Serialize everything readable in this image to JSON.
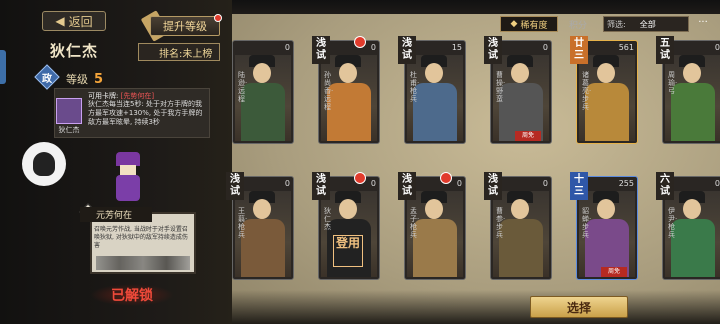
{
  "left": {
    "back_label": "返回",
    "upgrade_label": "提升等级",
    "hero_name": "狄仁杰",
    "rank_label": "排名:未上榜",
    "faction": "政",
    "level_label": "等级",
    "level_value": "5",
    "card_title": "可用卡牌:",
    "card_warning": "[先势何在]",
    "card_thumb_label": "狄仁杰",
    "card_desc": "狄仁杰每当连5秒: 处于对方手牌的我方最军攻速+130%, 处于我方手牌的敌方最军眩晕, 持续3秒",
    "skill_title": "元芳何在",
    "skill_desc": "召唤元芳作战, 当战时于对手设置召唤狄狱, 对狄狱中的敌军持续造成伤害",
    "unlocked_label": "已解锁"
  },
  "right": {
    "tab_active": "稀有度",
    "tab_inactive": "积分",
    "filter_label": "筛选:",
    "filter_value": "全部",
    "more_label": "···",
    "select_label": "选择",
    "cards": [
      {
        "rank": "",
        "cost": "0",
        "vlabel": "陆逊·远程",
        "tag": "",
        "frame": "normal",
        "body": "#3c5a3a"
      },
      {
        "rank": "浅试",
        "cost": "0",
        "vlabel": "孙尚香·远程",
        "tag": "",
        "frame": "normal",
        "body": "#c27a35",
        "alert": true
      },
      {
        "rank": "浅试",
        "cost": "15",
        "vlabel": "杜甫·枪兵",
        "tag": "",
        "frame": "normal",
        "body": "#4d6a8c"
      },
      {
        "rank": "浅试",
        "cost": "0",
        "vlabel": "曹操·野蛮",
        "tag": "周免",
        "frame": "normal",
        "body": "#555"
      },
      {
        "rank": "廿三",
        "cost": "561",
        "vlabel": "诸葛亮·步兵",
        "tag": "",
        "frame": "gold",
        "body": "#b8893a"
      },
      {
        "rank": "五试",
        "cost": "0",
        "vlabel": "周瑜·弓",
        "tag": "",
        "frame": "normal",
        "body": "#4a7a3a"
      },
      {
        "rank": "浅试",
        "cost": "0",
        "vlabel": "王翦·枪兵",
        "tag": "",
        "frame": "normal",
        "body": "#7a5a3a"
      },
      {
        "rank": "浅试",
        "cost": "0",
        "vlabel": "狄仁杰",
        "tag": "",
        "frame": "normal",
        "body": "#222",
        "alert": true,
        "stamp": "登用"
      },
      {
        "rank": "浅试",
        "cost": "0",
        "vlabel": "孟子·枪兵",
        "tag": "",
        "frame": "normal",
        "body": "#9a7a4a",
        "alert": true
      },
      {
        "rank": "浅试",
        "cost": "0",
        "vlabel": "曹参·步兵",
        "tag": "",
        "frame": "normal",
        "body": "#6a5a3a"
      },
      {
        "rank": "十三",
        "cost": "255",
        "vlabel": "貂蝉·步兵",
        "tag": "周免",
        "frame": "blue",
        "body": "#7a4a8a"
      },
      {
        "rank": "六试",
        "cost": "0",
        "vlabel": "伊尹·枪兵",
        "tag": "",
        "frame": "normal",
        "body": "#3a7a4a"
      }
    ]
  }
}
